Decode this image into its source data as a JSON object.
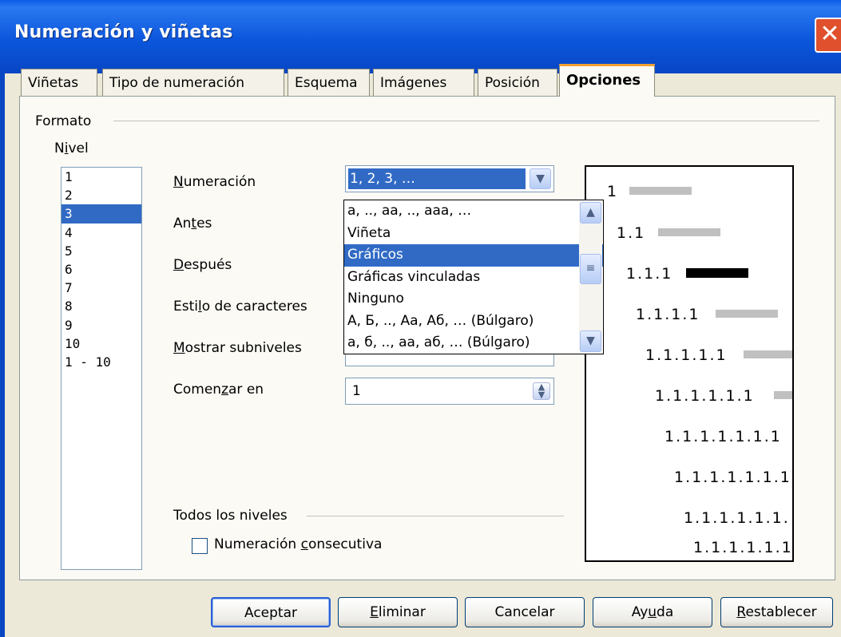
{
  "window": {
    "title": "Numeración y viñetas"
  },
  "tabs": [
    {
      "label": "Viñetas"
    },
    {
      "label": "Tipo de numeración"
    },
    {
      "label": "Esquema"
    },
    {
      "label": "Imágenes"
    },
    {
      "label": "Posición"
    },
    {
      "label": "Opciones",
      "active": true
    }
  ],
  "format": {
    "section_label": "Formato",
    "level_label": "Nivel",
    "levels": [
      "1",
      "2",
      "3",
      "4",
      "5",
      "6",
      "7",
      "8",
      "9",
      "10",
      "1 - 10"
    ],
    "selected_level": "3"
  },
  "fields": {
    "numeracion": {
      "label": "Numeración",
      "value": "1, 2, 3, …"
    },
    "antes": {
      "label": "Antes"
    },
    "despues": {
      "label": "Después"
    },
    "estilo": {
      "label": "Estilo de caracteres"
    },
    "mostrar": {
      "label": "Mostrar subniveles"
    },
    "comenzar": {
      "label": "Comenzar en",
      "value": "1"
    }
  },
  "dropdown": {
    "options": [
      "a, .., aa, .., aaa, …",
      "Viñeta",
      "Gráficos",
      "Gráficas vinculadas",
      "Ninguno",
      "А, Б, .., Аа, Аб, … (Búlgaro)",
      "а, б, .., аа, аб, … (Búlgaro)"
    ],
    "selected": "Gráficos"
  },
  "all_levels": {
    "section_label": "Todos los niveles",
    "checkbox_label": "Numeración consecutiva",
    "checked": false
  },
  "preview": {
    "lines": [
      "1",
      "1.1",
      "1.1.1",
      "1.1.1.1",
      "1.1.1.1.1",
      "1.1.1.1.1.1",
      "1.1.1.1.1.1.1",
      "1.1.1.1.1.1.1",
      "1.1.1.1.1.1.",
      "1.1.1.1.1.1"
    ]
  },
  "buttons": {
    "ok": "Aceptar",
    "delete": "Eliminar",
    "cancel": "Cancelar",
    "help": "Ayuda",
    "reset": "Restablecer"
  }
}
